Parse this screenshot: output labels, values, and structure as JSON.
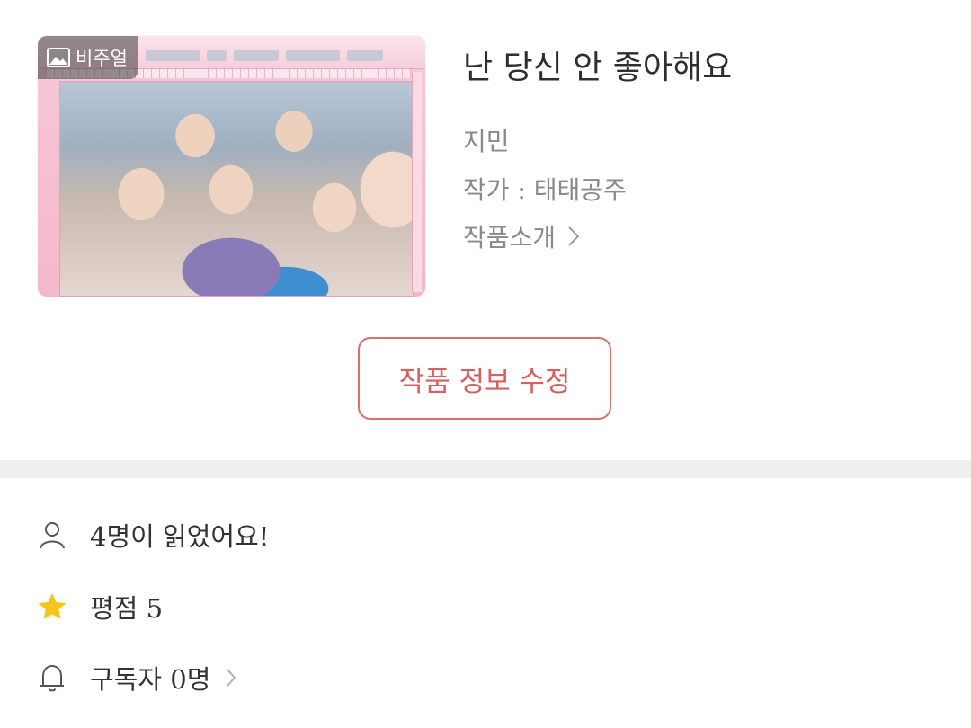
{
  "cover": {
    "badge_label": "비주얼",
    "badge_icon": "image-icon"
  },
  "work": {
    "title": "난 당신 안 좋아해요",
    "genre": "지민",
    "author": "작가 : 태태공주",
    "intro_label": "작품소개"
  },
  "actions": {
    "edit_label": "작품 정보 수정"
  },
  "stats": {
    "readers_label": "4명이 읽었어요!",
    "rating_label": "평점 5",
    "subscribers_label": "구독자 0명"
  },
  "colors": {
    "accent": "#de6d6d",
    "star": "#f5c518",
    "divider": "#efefef",
    "muted_text": "#8a8a8a"
  }
}
